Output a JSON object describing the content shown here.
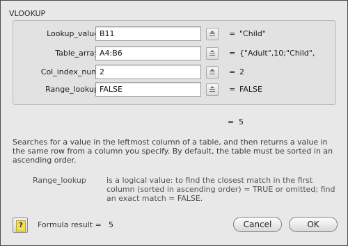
{
  "dialog": {
    "function_name": "VLOOKUP",
    "arguments": [
      {
        "label": "Lookup_value",
        "input": "B11",
        "result": "\"Child\""
      },
      {
        "label": "Table_array",
        "input": "A4:B6",
        "result": "{\"Adult\",10;\"Child\","
      },
      {
        "label": "Col_index_num",
        "input": "2",
        "result": "2"
      },
      {
        "label": "Range_lookup",
        "input": "FALSE",
        "result": "FALSE"
      }
    ],
    "equals": "=",
    "function_result": "5",
    "description": "Searches for a value in the leftmost column of a table, and then returns a value in the same row from a column you specify. By default, the table must be sorted in an ascending order.",
    "arg_help": {
      "name": "Range_lookup",
      "text": "is a logical value: to find the closest match in the first column (sorted in ascending order) = TRUE or omitted; find an exact match = FALSE."
    },
    "formula_result_label": "Formula result =",
    "formula_result_value": "5",
    "help_glyph": "?",
    "buttons": {
      "cancel": "Cancel",
      "ok": "OK"
    },
    "icons": {
      "ref": "collapse-dialog-icon",
      "help": "help-icon"
    }
  }
}
